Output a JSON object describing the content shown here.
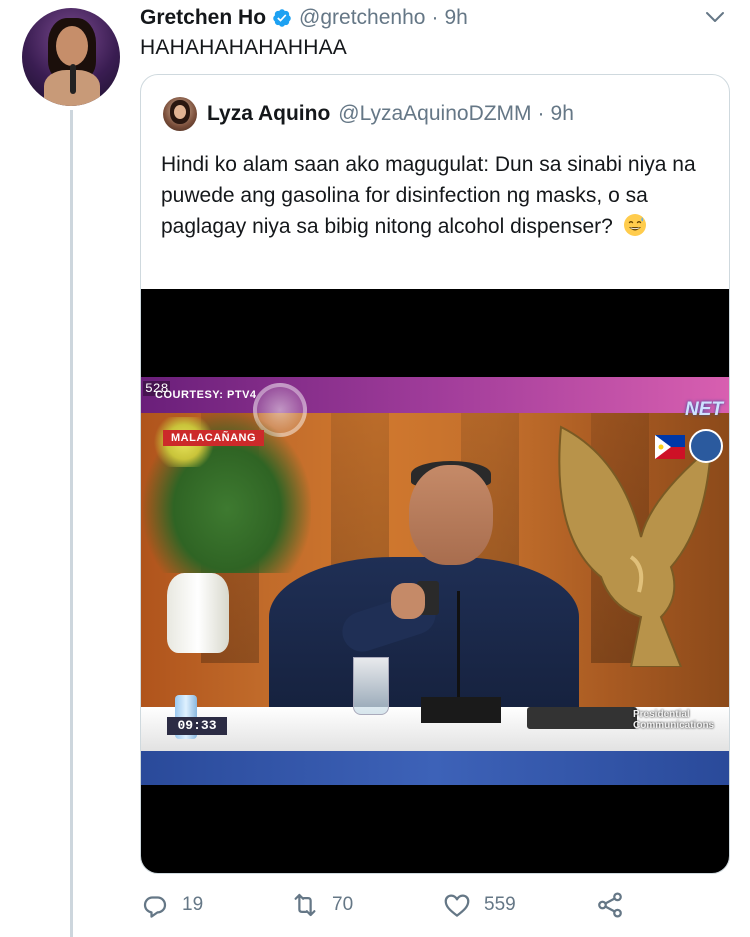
{
  "tweet": {
    "author": {
      "name": "Gretchen Ho",
      "handle": "@gretchenho",
      "time": "9h",
      "verified": true
    },
    "text": "HAHAHAHAHAHHAA"
  },
  "quoted": {
    "author": {
      "name": "Lyza Aquino",
      "handle": "@LyzaAquinoDZMM",
      "time": "9h"
    },
    "text": "Hindi ko alam saan ako magugulat: Dun sa sinabi niya na puwede ang gasolina for disinfection ng masks, o sa paglagay niya sa bibig nitong alcohol dispenser?",
    "emoji": "grinning-sweat-emoji",
    "media": {
      "overlay_number": "528",
      "courtesy": "COURTESY: PTV4",
      "location_tag": "MALACAÑANG",
      "channel": "NET",
      "clock": "09:33",
      "caption": "Presidential Communications"
    }
  },
  "actions": {
    "replies": "19",
    "retweets": "70",
    "likes": "559"
  },
  "colors": {
    "text": "#14171a",
    "muted": "#657786",
    "border": "#cfd9de",
    "verified": "#1da1f2"
  }
}
